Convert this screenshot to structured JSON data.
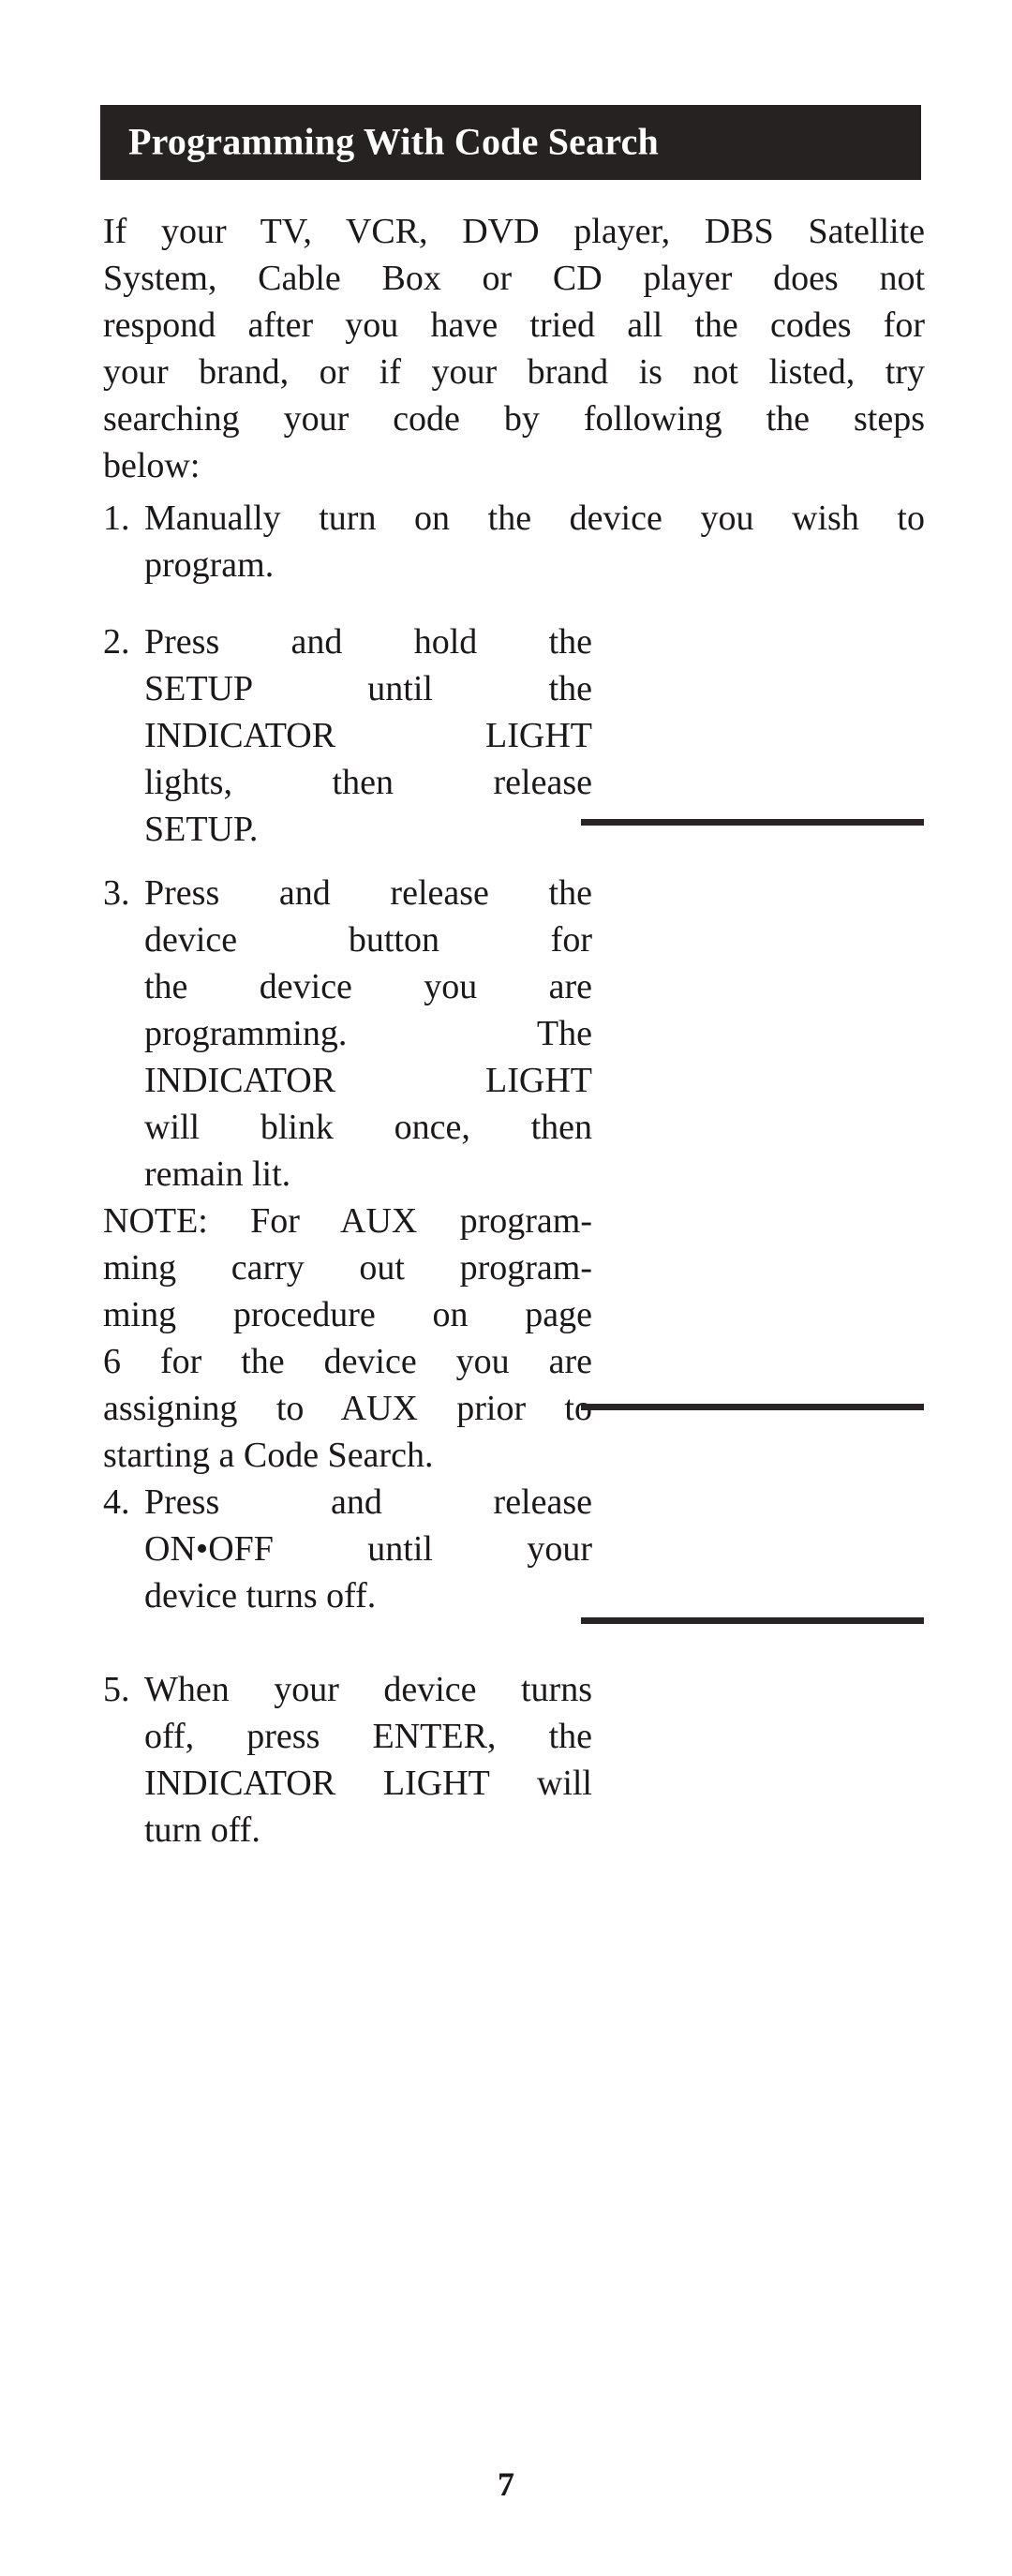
{
  "header": {
    "title": "Programming With Code Search"
  },
  "intro": {
    "lines": [
      "If your TV, VCR, DVD player, DBS Satellite",
      "System, Cable Box or CD player does not",
      "respond after you have tried all the codes for",
      "your brand, or if your brand is not listed, try",
      "searching your code by following the steps",
      "below:"
    ],
    "text": "If your TV, VCR, DVD player, DBS Satellite System, Cable Box or CD player does not respond after you have tried all the codes for your brand, or if your brand is not listed, try searching your code by following the steps below:"
  },
  "steps": [
    {
      "number": "1.",
      "lines": [
        "Manually turn on the device you wish to",
        "program."
      ],
      "text": "Manually turn on the device you wish to program."
    },
    {
      "number": "2.",
      "lines": [
        "Press and hold the",
        "SETUP until the",
        "INDICATOR LIGHT",
        "lights, then release",
        "SETUP."
      ],
      "text": "Press and hold the SETUP until the INDICATOR LIGHT lights, then release SETUP."
    },
    {
      "number": "3.",
      "lines": [
        "Press and release the",
        "device button for",
        "the device you are",
        "programming. The",
        "INDICATOR LIGHT",
        "will blink once, then",
        "remain lit."
      ],
      "text": "Press and release the device button for the device you are programming. The INDICATOR LIGHT will blink once, then remain lit."
    },
    {
      "number": "4.",
      "lines": [
        "Press and release",
        "ON•OFF until your",
        "device turns off."
      ],
      "text": "Press and release ON•OFF until your device turns off."
    },
    {
      "number": "5.",
      "lines": [
        "When your device turns",
        "off, press ENTER, the",
        "INDICATOR LIGHT will",
        "turn off."
      ],
      "text": "When your device turns off, press ENTER, the INDICATOR LIGHT will turn off."
    }
  ],
  "note": {
    "lines": [
      "NOTE: For AUX program-",
      "ming carry out program-",
      "ming procedure on page",
      "6 for the device you are",
      "assigning to AUX prior to",
      "starting a Code Search."
    ],
    "text": "NOTE: For AUX programming carry out programming procedure on page 6 for the device you are assigning to AUX prior to starting a Code Search."
  },
  "footer": {
    "page_number": "7"
  },
  "colors": {
    "title_bar_background": "#262222",
    "title_text": "#ffffff",
    "body_text": "#1c1718",
    "rule": "#2a2323",
    "page_background": "#ffffff"
  }
}
